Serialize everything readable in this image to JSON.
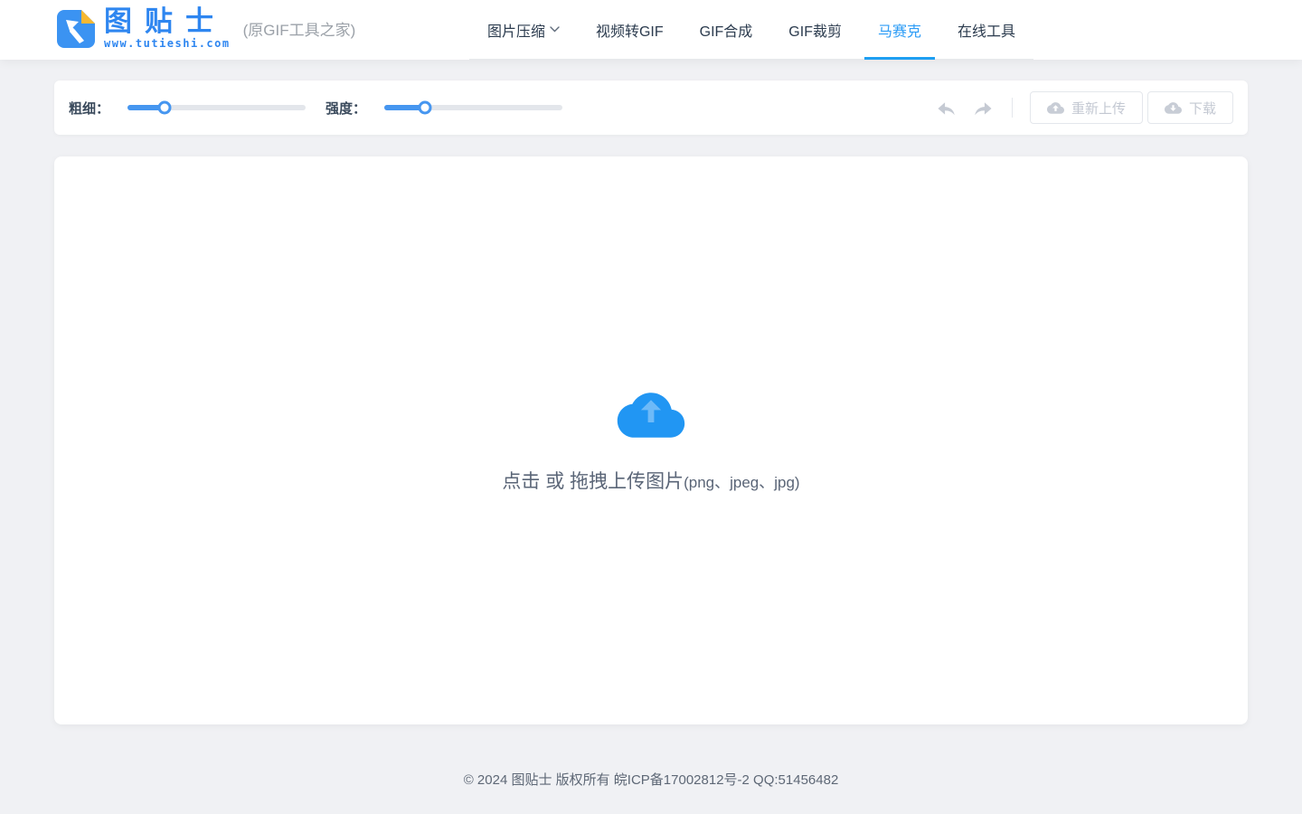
{
  "header": {
    "logo": {
      "title": "图贴士",
      "url": "www.tutieshi.com",
      "subtitle": "(原GIF工具之家)"
    },
    "nav": [
      {
        "label": "图片压缩",
        "has_dropdown": true
      },
      {
        "label": "视频转GIF"
      },
      {
        "label": "GIF合成"
      },
      {
        "label": "GIF裁剪"
      },
      {
        "label": "马赛克",
        "active": true
      },
      {
        "label": "在线工具"
      }
    ]
  },
  "toolbar": {
    "thickness": {
      "label": "粗细：",
      "percent": 21
    },
    "strength": {
      "label": "强度：",
      "percent": 23
    },
    "reupload_label": "重新上传",
    "download_label": "下载"
  },
  "upload": {
    "main_text": "点击 或 拖拽上传图片",
    "formats_text": "(png、jpeg、jpg)"
  },
  "footer": {
    "copyright": "© 2024 图贴士 版权所有 皖ICP备17002812号-2 QQ:51456482"
  },
  "icons": {
    "logo": "logo-arrow-icon",
    "nav_dropdown": "chevron-down-icon",
    "undo": "undo-arrow-icon",
    "redo": "redo-arrow-icon",
    "reupload": "cloud-upload-icon",
    "download": "cloud-download-icon",
    "upload_area": "cloud-upload-icon"
  },
  "colors": {
    "accent_blue": "#2196f3",
    "nav_active_blue": "#2d9cf6",
    "slider_blue": "#4696f0",
    "logo_blue": "#2e86f0",
    "logo_fold_yellow": "#f6b832",
    "disabled_gray": "#c5cad3",
    "page_background": "#f0f1f4"
  }
}
